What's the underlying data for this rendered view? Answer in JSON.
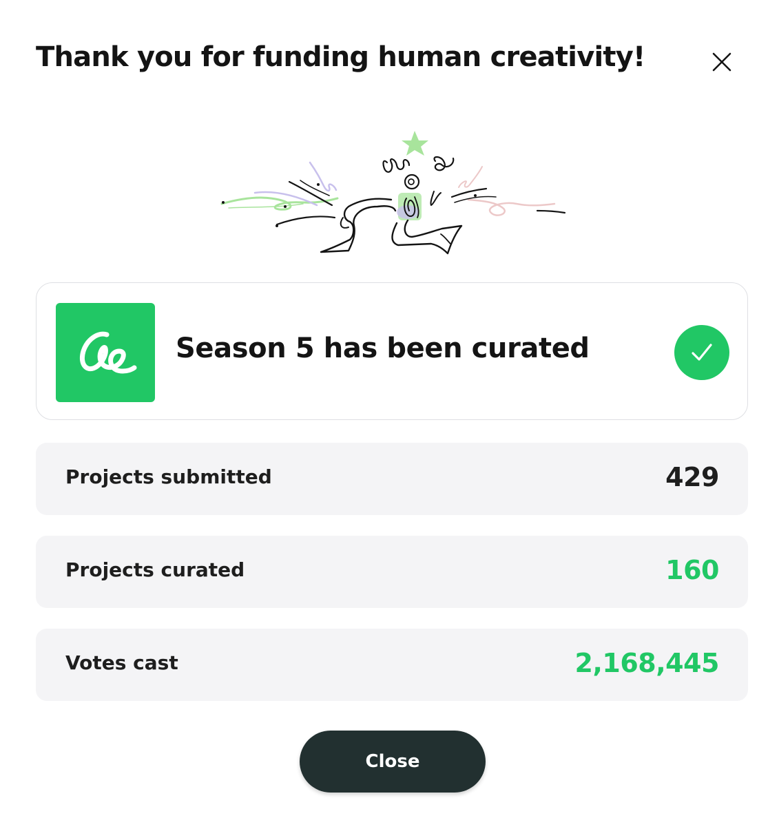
{
  "dialog": {
    "title": "Thank you for funding human creativity!",
    "close_icon": "close-x-icon"
  },
  "illustration": {
    "icon": "celebrating-figure-illustration",
    "colors": [
      "#a8e49c",
      "#c8c0ec",
      "#ecc8c8",
      "#141414"
    ]
  },
  "season": {
    "text": "Season 5 has been curated",
    "logo_icon": "curation-logo-icon",
    "status_icon": "checkmark-icon"
  },
  "stats": [
    {
      "label": "Projects submitted",
      "value": "429",
      "color": "#1e1e1e"
    },
    {
      "label": "Projects curated",
      "value": "160",
      "color": "#21c765"
    },
    {
      "label": "Votes cast",
      "value": "2,168,445",
      "color": "#21c765"
    }
  ],
  "footer": {
    "close_label": "Close"
  },
  "colors": {
    "accent_green": "#21c765",
    "button_dark": "#223030",
    "row_background": "#f4f4f6",
    "card_border": "#dedfe3"
  }
}
